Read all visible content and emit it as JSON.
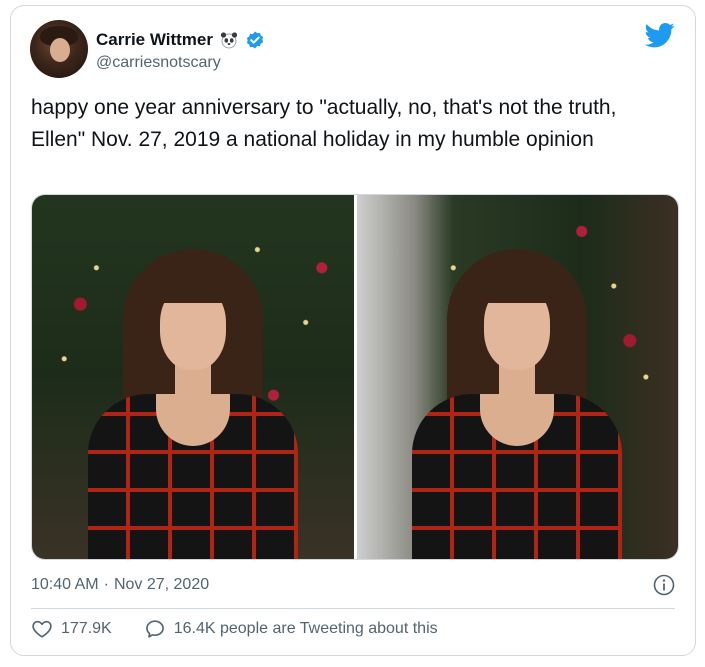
{
  "author": {
    "display_name": "Carrie Wittmer",
    "handle": "@carriesnotscary",
    "verified": true,
    "emoji_badge": "panda-face-icon"
  },
  "brand": {
    "logo": "twitter-bird-icon",
    "accent_color": "#1d9bf0"
  },
  "tweet": {
    "text": "happy one year anniversary to \"actually, no, that's not the truth, Ellen\" Nov. 27, 2019 a national holiday in my humble opinion",
    "media_count": 2
  },
  "meta": {
    "time": "10:40 AM",
    "separator": "·",
    "date": "Nov 27, 2020"
  },
  "actions": {
    "likes": "177.9K",
    "conversation": "16.4K people are Tweeting about this"
  },
  "colors": {
    "text": "#0f1419",
    "muted": "#536471",
    "border": "#cfd9de"
  }
}
